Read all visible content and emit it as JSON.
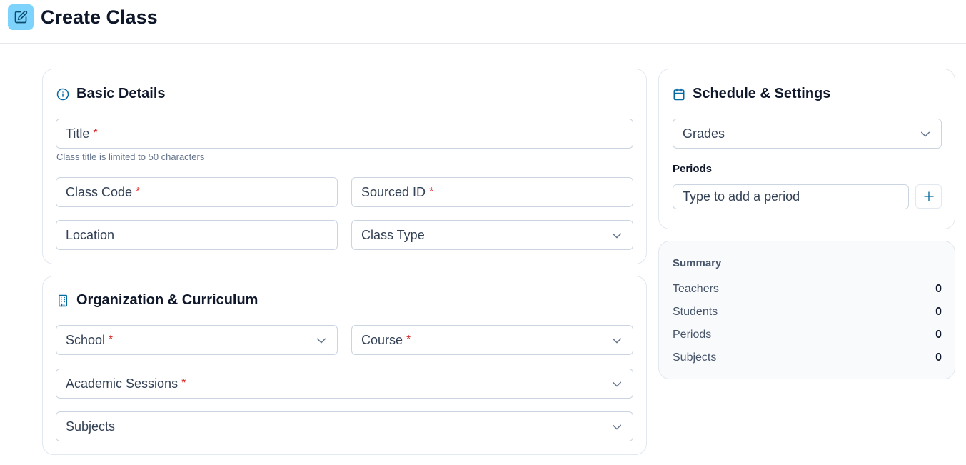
{
  "header": {
    "title": "Create Class"
  },
  "basic": {
    "title": "Basic Details",
    "title_field": {
      "label": "Title",
      "required": "*"
    },
    "title_hint": "Class title is limited to 50 characters",
    "class_code": {
      "label": "Class Code",
      "required": "*"
    },
    "sourced_id": {
      "label": "Sourced ID",
      "required": "*"
    },
    "location": {
      "label": "Location"
    },
    "class_type": {
      "label": "Class Type"
    }
  },
  "org": {
    "title": "Organization & Curriculum",
    "school": {
      "label": "School",
      "required": "*"
    },
    "course": {
      "label": "Course",
      "required": "*"
    },
    "academic_sessions": {
      "label": "Academic Sessions",
      "required": "*"
    },
    "subjects": {
      "label": "Subjects"
    }
  },
  "schedule": {
    "title": "Schedule & Settings",
    "grades": {
      "label": "Grades"
    },
    "periods_label": "Periods",
    "period_placeholder": "Type to add a period"
  },
  "summary": {
    "title": "Summary",
    "rows": [
      {
        "label": "Teachers",
        "value": "0"
      },
      {
        "label": "Students",
        "value": "0"
      },
      {
        "label": "Periods",
        "value": "0"
      },
      {
        "label": "Subjects",
        "value": "0"
      }
    ]
  },
  "colors": {
    "accent": "#0369a1",
    "header_icon_bg": "#7dd3fc",
    "required": "#dc2626"
  },
  "icons": {
    "header": "edit-square-icon",
    "basic": "info-circle-icon",
    "org": "building-icon",
    "schedule": "calendar-icon",
    "chevron": "chevron-down-icon",
    "add": "plus-icon"
  }
}
